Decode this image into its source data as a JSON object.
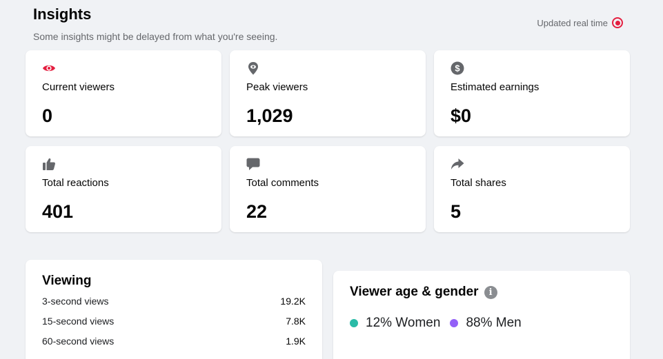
{
  "header": {
    "title": "Insights",
    "subtitle": "Some insights might be delayed from what you're seeing.",
    "realtime_label": "Updated real time"
  },
  "stats": [
    {
      "icon": "eye-icon",
      "label": "Current viewers",
      "value": "0"
    },
    {
      "icon": "location-pin-icon",
      "label": "Peak viewers",
      "value": "1,029"
    },
    {
      "icon": "dollar-icon",
      "label": "Estimated earnings",
      "value": "$0"
    },
    {
      "icon": "thumbs-up-icon",
      "label": "Total reactions",
      "value": "401"
    },
    {
      "icon": "comment-icon",
      "label": "Total comments",
      "value": "22"
    },
    {
      "icon": "share-icon",
      "label": "Total shares",
      "value": "5"
    }
  ],
  "viewing": {
    "title": "Viewing",
    "rows": [
      {
        "label": "3-second views",
        "value": "19.2K"
      },
      {
        "label": "15-second views",
        "value": "7.8K"
      },
      {
        "label": "60-second views",
        "value": "1.9K"
      }
    ]
  },
  "age_gender": {
    "title": "Viewer age & gender",
    "women": {
      "label": "12% Women",
      "color": "#2abba7"
    },
    "men": {
      "label": "88% Men",
      "color": "#9360f7"
    }
  },
  "colors": {
    "accent_red": "#e41e3f",
    "icon_gray": "#65676b"
  }
}
